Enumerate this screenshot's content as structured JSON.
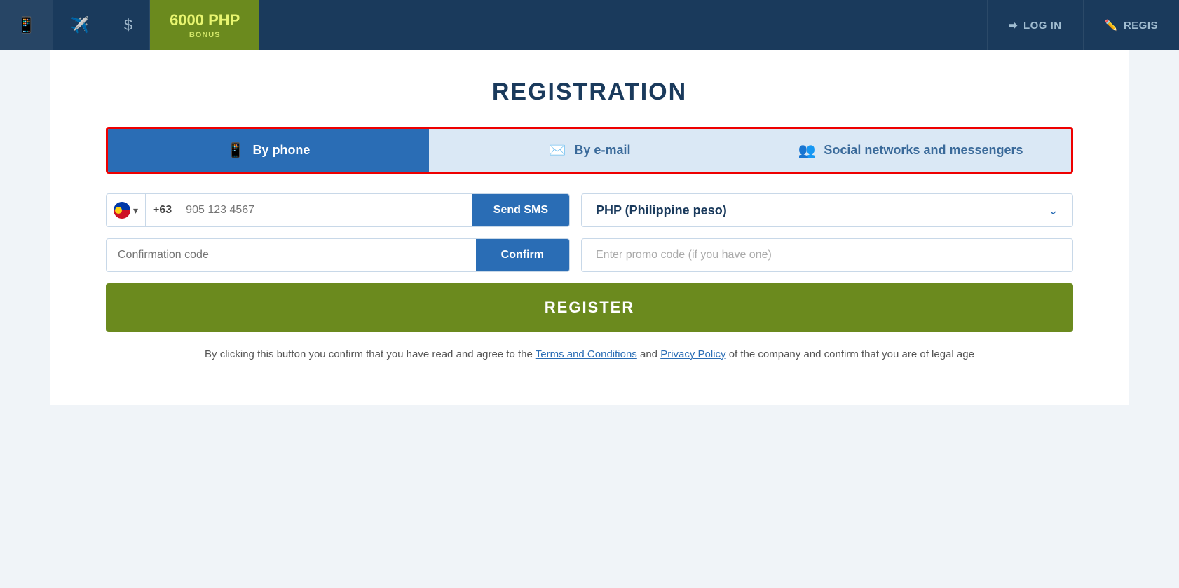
{
  "nav": {
    "bonus_amount": "6000 PHP",
    "bonus_label": "BONUS",
    "login_label": "LOG IN",
    "register_label": "REGIS"
  },
  "page": {
    "title": "REGISTRATION"
  },
  "tabs": [
    {
      "id": "phone",
      "label": "By phone",
      "active": true
    },
    {
      "id": "email",
      "label": "By e-mail",
      "active": false
    },
    {
      "id": "social",
      "label": "Social networks and messengers",
      "active": false
    }
  ],
  "form": {
    "phone_code": "+63",
    "phone_placeholder": "905 123 4567",
    "send_sms_label": "Send SMS",
    "currency_label": "PHP (Philippine peso)",
    "confirmation_code_placeholder": "Confirmation code",
    "confirm_label": "Confirm",
    "promo_placeholder": "Enter promo code (if you have one)",
    "register_label": "REGISTER",
    "terms_text_before": "By clicking this button you confirm that you have read and agree to the ",
    "terms_link1": "Terms and Conditions",
    "terms_text_middle": " and ",
    "terms_link2": "Privacy Policy",
    "terms_text_after": " of the company and confirm that you are of legal age"
  }
}
